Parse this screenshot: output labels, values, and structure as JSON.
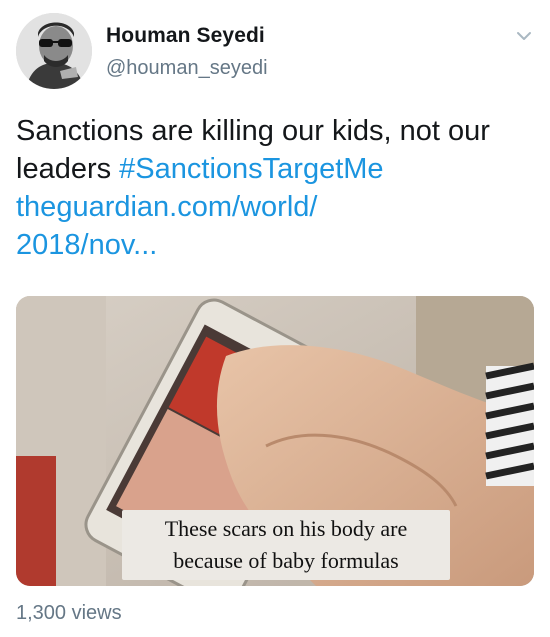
{
  "author": {
    "display_name": "Houman Seyedi",
    "handle": "@houman_seyedi"
  },
  "tweet": {
    "text": "Sanctions are killing our kids, not our leaders ",
    "hashtag": "#SanctionsTargetMe",
    "link_line1": "theguardian.com/world/",
    "link_line2": "2018/nov..."
  },
  "media": {
    "caption_line1": "These scars on his body are",
    "caption_line2": "because of baby formulas"
  },
  "stats": {
    "views": "1,300 views"
  },
  "colors": {
    "link": "#1b95e0",
    "secondary_text": "#657786",
    "primary_text": "#14171a"
  },
  "icons": {
    "more": "chevron-down-icon"
  }
}
